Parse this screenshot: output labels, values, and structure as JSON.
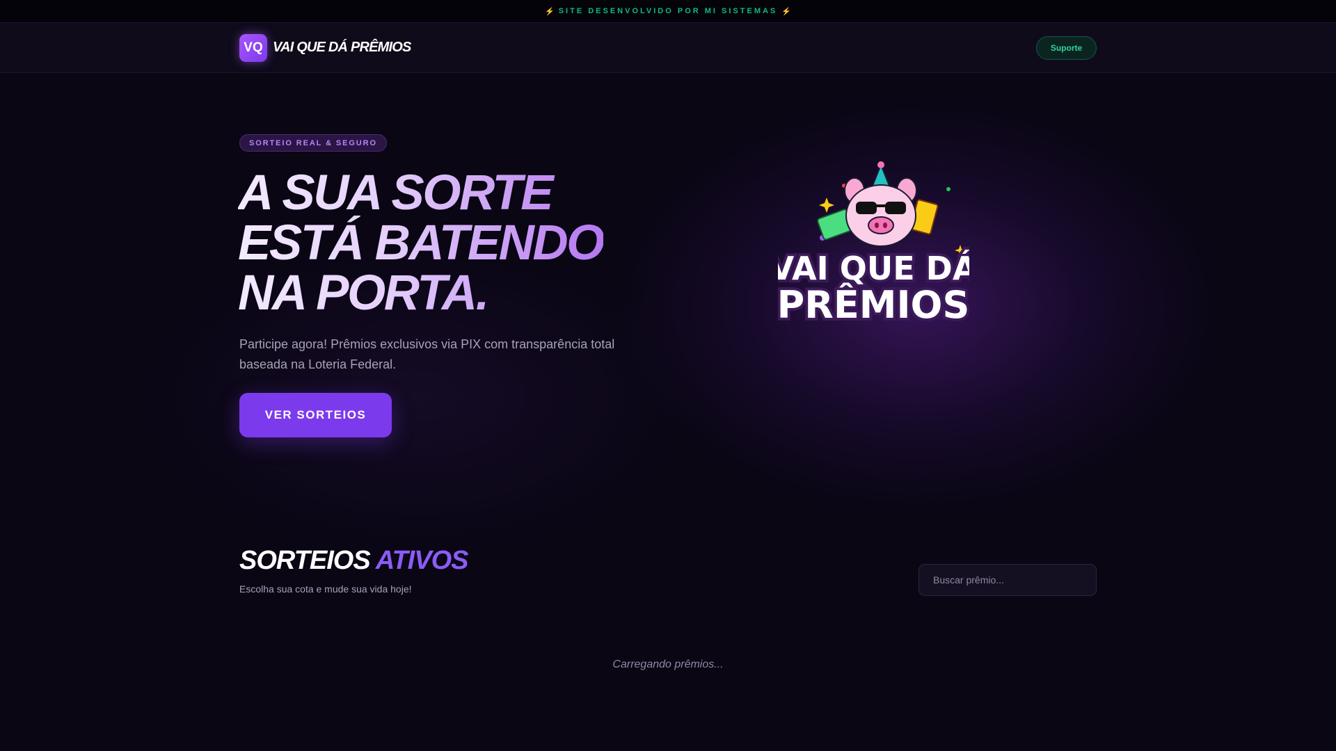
{
  "topbar": {
    "bolt": "⚡",
    "text": "SITE DESENVOLVIDO POR MI SISTEMAS"
  },
  "header": {
    "logo_initials": "VQ",
    "logo_text": "VAI QUE DÁ PRÊMIOS",
    "support_label": "Suporte"
  },
  "hero": {
    "badge": "SORTEIO REAL & SEGURO",
    "title_lines": [
      "A SUA SORTE",
      "ESTÁ BATENDO",
      "NA PORTA."
    ],
    "description": "Participe agora! Prêmios exclusivos via PIX com transparência total baseada na Loteria Federal.",
    "cta_label": "VER SORTEIOS",
    "mascot_text_line1": "VAI QUE DÁ",
    "mascot_text_line2": "PRÊMIOS"
  },
  "raffles": {
    "title_part1": "SORTEIOS",
    "title_part2": "ATIVOS",
    "subtitle": "Escolha sua cota e mude sua vida hoje!",
    "search_placeholder": "Buscar prêmio...",
    "loading_text": "Carregando prêmios..."
  },
  "colors": {
    "background": "#0a0614",
    "accent_purple": "#7c3aed",
    "accent_green": "#10b981",
    "bolt_yellow": "#facc15"
  }
}
